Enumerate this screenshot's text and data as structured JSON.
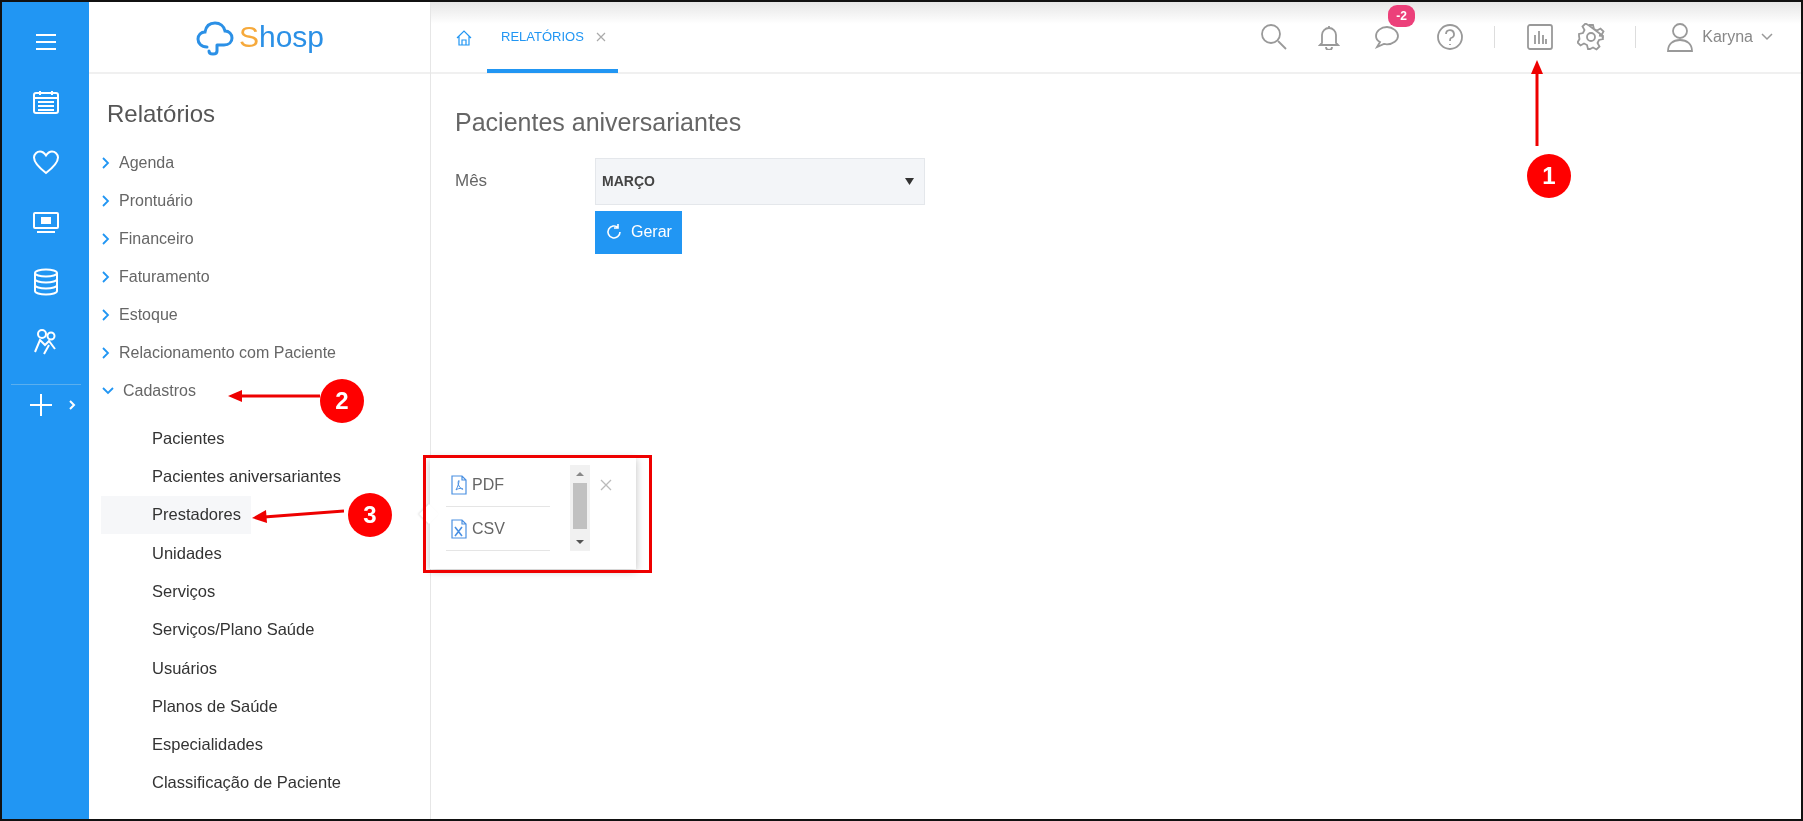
{
  "app": {
    "logo": "Shosp"
  },
  "tabs": [
    {
      "label": "RELATÓRIOS",
      "selected": true
    }
  ],
  "notifications": {
    "messages_badge": "-2"
  },
  "user": {
    "name": "Karyna"
  },
  "sidebar": {
    "title": "Relatórios",
    "items": [
      {
        "label": "Agenda",
        "expanded": false
      },
      {
        "label": "Prontuário",
        "expanded": false
      },
      {
        "label": "Financeiro",
        "expanded": false
      },
      {
        "label": "Faturamento",
        "expanded": false
      },
      {
        "label": "Estoque",
        "expanded": false
      },
      {
        "label": "Relacionamento com Paciente",
        "expanded": false
      },
      {
        "label": "Cadastros",
        "expanded": true,
        "children": [
          {
            "label": "Pacientes",
            "selected": false
          },
          {
            "label": "Pacientes aniversariantes",
            "selected": false
          },
          {
            "label": "Prestadores",
            "selected": true
          },
          {
            "label": "Unidades",
            "selected": false
          },
          {
            "label": "Serviços",
            "selected": false
          },
          {
            "label": "Serviços/Plano Saúde",
            "selected": false
          },
          {
            "label": "Usuários",
            "selected": false
          },
          {
            "label": "Planos de Saúde",
            "selected": false
          },
          {
            "label": "Especialidades",
            "selected": false
          },
          {
            "label": "Classificação de Paciente",
            "selected": false
          }
        ]
      }
    ]
  },
  "report": {
    "title": "Pacientes aniversariantes",
    "month_label": "Mês",
    "month_value": "MARÇO",
    "generate_button": "Gerar"
  },
  "export_menu": {
    "options": [
      {
        "label": "PDF",
        "kind": "pdf"
      },
      {
        "label": "CSV",
        "kind": "csv"
      }
    ]
  },
  "annotations": [
    {
      "label": "1"
    },
    {
      "label": "2"
    },
    {
      "label": "3"
    }
  ]
}
